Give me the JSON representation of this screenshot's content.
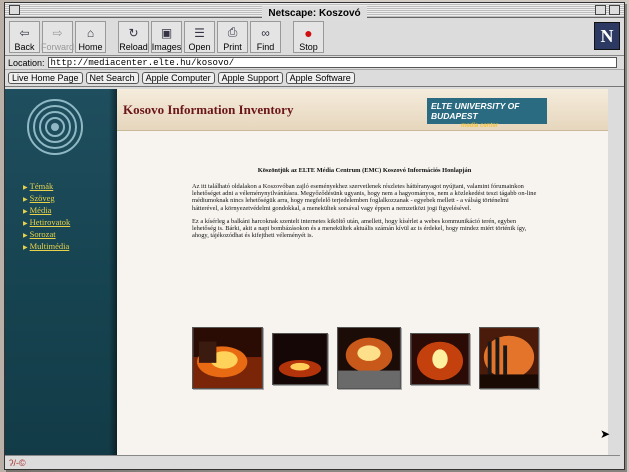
{
  "window": {
    "title": "Netscape: Koszovó"
  },
  "toolbar": {
    "back": "Back",
    "forward": "Forward",
    "home": "Home",
    "reload": "Reload",
    "images": "Images",
    "open": "Open",
    "print": "Print",
    "find": "Find",
    "stop": "Stop",
    "logo": "N"
  },
  "location": {
    "label": "Location:",
    "url": "http://mediacenter.elte.hu/kosovo/"
  },
  "directory": [
    "Live Home Page",
    "Net Search",
    "Apple Computer",
    "Apple Support",
    "Apple Software"
  ],
  "nav": {
    "items": [
      "Témák",
      "Szöveg",
      "Média",
      "Hetirovatok",
      "Sorozat",
      "Multimédia"
    ]
  },
  "page": {
    "title": "Kosovo Information Inventory",
    "brand": {
      "name": "ELTE UNIVERSITY OF BUDAPEST",
      "sub": "media center"
    },
    "heading": "Köszöntjük az ELTE Média Centrum (EMC) Koszovó Információs Honlapján",
    "para1": "Az itt található oldalakon a Koszovóban zajló eseményekhez szervetlenek részletes háttéranyagot nyújtani, valamint fórumainkon lehetőséget adni a véleménynyilvánításra. Megyőződésünk ugyanis, hogy nem a hagyományos, nem a közlekedést teszi tágabb on-line médiumoknak nincs lehetőségük arra, hogy megfelelő terjedelemben foglalkozzanak - egyebek mellett - a válság történelmi hátterével, a környezetvédelmi gondokkal, a menekültek sorsával vagy éppen a nemzetközi jogi figyelésével.",
    "para2": "Ez a kísérleg a balkáni harcoknak szentelt internetes kiköltő után, amellett, hogy kísérlet a webes kommunikáció terén, egyben lehetőség is. Bárki, akit a napi bombázásokon és a menekültek aktuális számán kívül az is érdekel, hogy mindez miért történik így, ahogy, tájékozódhat és kifejtheti véleményét is."
  },
  "photos": [
    "photo-1",
    "photo-2",
    "photo-3",
    "photo-4",
    "photo-5"
  ],
  "status": {
    "text": "ʔ/-©"
  }
}
